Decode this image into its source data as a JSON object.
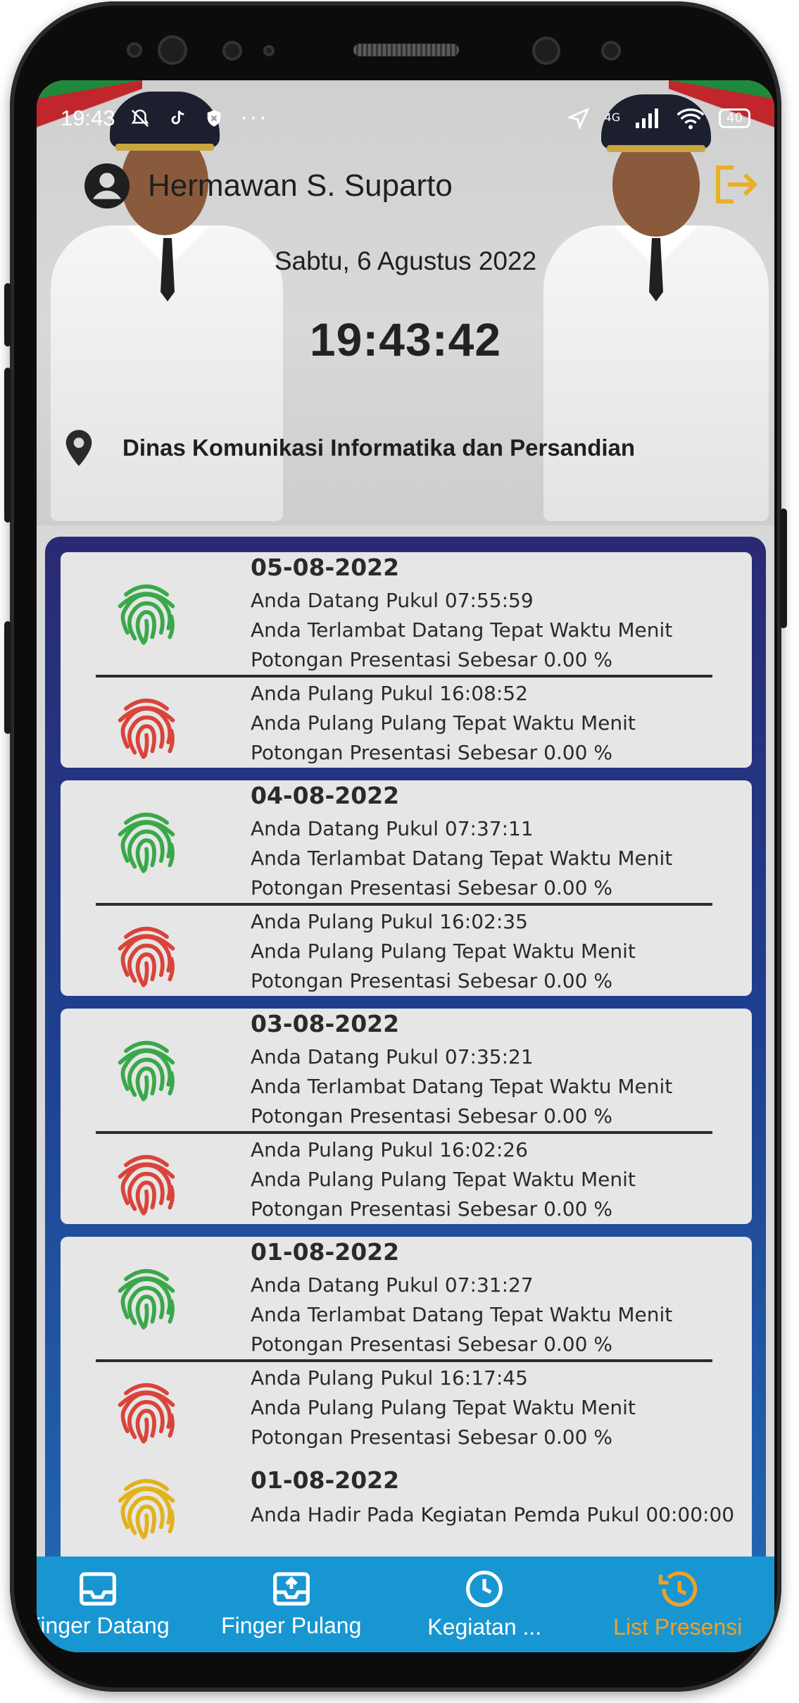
{
  "status_bar": {
    "time": "19:43",
    "signal_label": "4G",
    "battery": "40"
  },
  "header": {
    "user_name": "Hermawan S. Suparto",
    "date": "Sabtu, 6 Agustus 2022",
    "clock": "19:43:42",
    "location": "Dinas Komunikasi Informatika dan Persandian"
  },
  "colors": {
    "nav_bg": "#1896d2",
    "nav_active": "#f2a024",
    "fp_in": "#3aa84a",
    "fp_out": "#d9443a",
    "fp_event": "#e2b21c",
    "list_top": "#2a2a73",
    "list_bottom": "#2168b3"
  },
  "records": [
    {
      "date": "05-08-2022",
      "in": [
        "Anda Datang Pukul 07:55:59",
        "Anda Terlambat Datang Tepat Waktu Menit",
        "Potongan Presentasi Sebesar 0.00 %"
      ],
      "out": [
        "Anda Pulang Pukul 16:08:52",
        "Anda Pulang Pulang Tepat Waktu Menit",
        "Potongan Presentasi Sebesar 0.00 %"
      ]
    },
    {
      "date": "04-08-2022",
      "in": [
        "Anda Datang Pukul 07:37:11",
        "Anda Terlambat Datang Tepat Waktu Menit",
        "Potongan Presentasi Sebesar 0.00 %"
      ],
      "out": [
        "Anda Pulang Pukul 16:02:35",
        "Anda Pulang Pulang Tepat Waktu Menit",
        "Potongan Presentasi Sebesar 0.00 %"
      ]
    },
    {
      "date": "03-08-2022",
      "in": [
        "Anda Datang Pukul 07:35:21",
        "Anda Terlambat Datang Tepat Waktu Menit",
        "Potongan Presentasi Sebesar 0.00 %"
      ],
      "out": [
        "Anda Pulang Pukul 16:02:26",
        "Anda Pulang Pulang Tepat Waktu Menit",
        "Potongan Presentasi Sebesar 0.00 %"
      ]
    },
    {
      "date": "01-08-2022",
      "in": [
        "Anda Datang Pukul 07:31:27",
        "Anda Terlambat Datang Tepat Waktu Menit",
        "Potongan Presentasi Sebesar 0.00 %"
      ],
      "out": [
        "Anda Pulang Pukul 16:17:45",
        "Anda Pulang Pulang Tepat Waktu Menit",
        "Potongan Presentasi Sebesar 0.00 %"
      ],
      "event": {
        "date": "01-08-2022",
        "line": "Anda Hadir Pada Kegiatan Pemda Pukul 00:00:00"
      }
    }
  ],
  "nav": [
    {
      "label": "Finger Datang",
      "icon": "inbox-icon",
      "active": false
    },
    {
      "label": "Finger Pulang",
      "icon": "outbox-icon",
      "active": false
    },
    {
      "label": "Kegiatan ...",
      "icon": "clock-icon",
      "active": false
    },
    {
      "label": "List Presensi",
      "icon": "history-icon",
      "active": true
    }
  ]
}
